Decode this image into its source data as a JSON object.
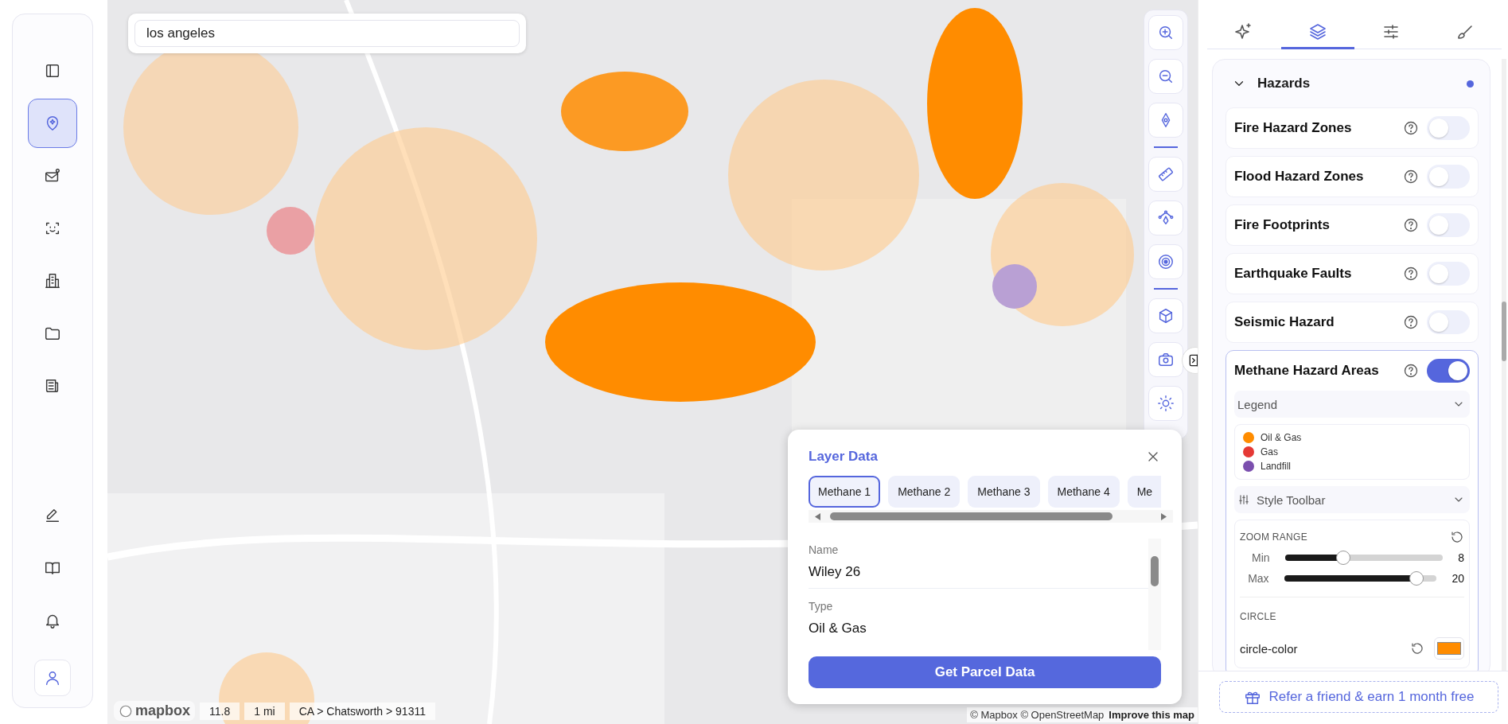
{
  "sidebar": {
    "top_items": [
      {
        "selected": false
      },
      {
        "selected": true
      },
      {
        "selected": false
      },
      {
        "selected": false
      },
      {
        "selected": false
      },
      {
        "selected": false
      },
      {
        "selected": false
      }
    ],
    "bottom_items": [
      {
        "selected": false
      },
      {
        "selected": false
      },
      {
        "selected": false
      }
    ]
  },
  "search": {
    "value": "los angeles"
  },
  "status_bar": {
    "logo": "mapbox",
    "zoom": "11.8",
    "scale": "1 mi",
    "breadcrumb": "CA > Chatsworth > 91311",
    "attribution": "© Mapbox © OpenStreetMap",
    "improve_link": "Improve this map"
  },
  "layer_data": {
    "title": "Layer Data",
    "tabs": [
      {
        "label": "Methane 1",
        "selected": true
      },
      {
        "label": "Methane 2",
        "selected": false
      },
      {
        "label": "Methane 3",
        "selected": false
      },
      {
        "label": "Methane 4",
        "selected": false
      },
      {
        "label": "Me",
        "selected": false
      }
    ],
    "fields": [
      {
        "label": "Name",
        "value": "Wiley 26"
      },
      {
        "label": "Type",
        "value": "Oil & Gas"
      }
    ],
    "button": "Get Parcel Data"
  },
  "panel": {
    "tabs": [
      {
        "selected": false
      },
      {
        "selected": true
      },
      {
        "selected": false
      },
      {
        "selected": false
      }
    ],
    "section": {
      "title": "Hazards",
      "expanded": true,
      "active_indicator": true,
      "layers": [
        {
          "name": "Fire Hazard Zones",
          "on": false
        },
        {
          "name": "Flood Hazard Zones",
          "on": false
        },
        {
          "name": "Fire Footprints",
          "on": false
        },
        {
          "name": "Earthquake Faults",
          "on": false
        },
        {
          "name": "Seismic Hazard",
          "on": false
        },
        {
          "name": "Methane Hazard Areas",
          "on": true,
          "legend": {
            "title": "Legend",
            "items": [
              {
                "label": "Oil & Gas",
                "color": "#ff8c00"
              },
              {
                "label": "Gas",
                "color": "#e53935"
              },
              {
                "label": "Landfill",
                "color": "#7b4fae"
              }
            ]
          },
          "style_toolbar": {
            "title": "Style Toolbar",
            "zoom_range": {
              "title": "ZOOM RANGE",
              "sliders": [
                {
                  "label": "Min",
                  "level": 0.37,
                  "reading": "8"
                },
                {
                  "label": "Max",
                  "level": 0.87,
                  "reading": "20"
                }
              ]
            },
            "circle": {
              "title": "CIRCLE",
              "properties": [
                {
                  "name": "circle-color",
                  "color": "#ff8c00"
                }
              ]
            }
          }
        }
      ]
    },
    "refer_button": "Refer a friend & earn 1 month free"
  }
}
